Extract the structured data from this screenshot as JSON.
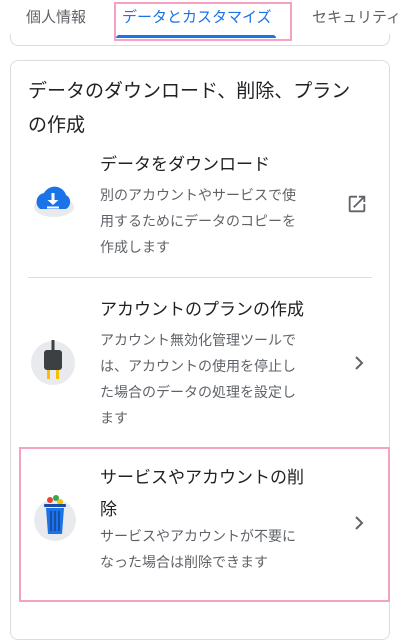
{
  "tabs": [
    {
      "label": "個人情報"
    },
    {
      "label": "データとカスタマイズ"
    },
    {
      "label": "セキュリティ"
    }
  ],
  "section": {
    "title_line1": "データのダウンロード、削除、プラン",
    "title_line2": "の作成"
  },
  "items": [
    {
      "title": "データをダウンロード",
      "desc": [
        "別のアカウントやサービスで使",
        "用するためにデータのコピーを",
        "作成します"
      ],
      "icon": "cloud-download-icon",
      "action_icon": "open-in-new-icon"
    },
    {
      "title": "アカウントのプランの作成",
      "desc": [
        "アカウント無効化管理ツールで",
        "は、アカウントの使用を停止し",
        "た場合のデータの処理を設定し",
        "ます"
      ],
      "icon": "power-plug-icon",
      "action_icon": "chevron-right-icon"
    },
    {
      "title_line1": "サービスやアカウントの削",
      "title_line2": "除",
      "desc": [
        "サービスやアカウントが不要に",
        "なった場合は削除できます"
      ],
      "icon": "trash-can-icon",
      "action_icon": "chevron-right-icon"
    }
  ],
  "colors": {
    "accent": "#1a73e8",
    "highlight": "#f3a2c4",
    "text_primary": "#202124",
    "text_secondary": "#5f6368",
    "divider": "#dadce0"
  }
}
